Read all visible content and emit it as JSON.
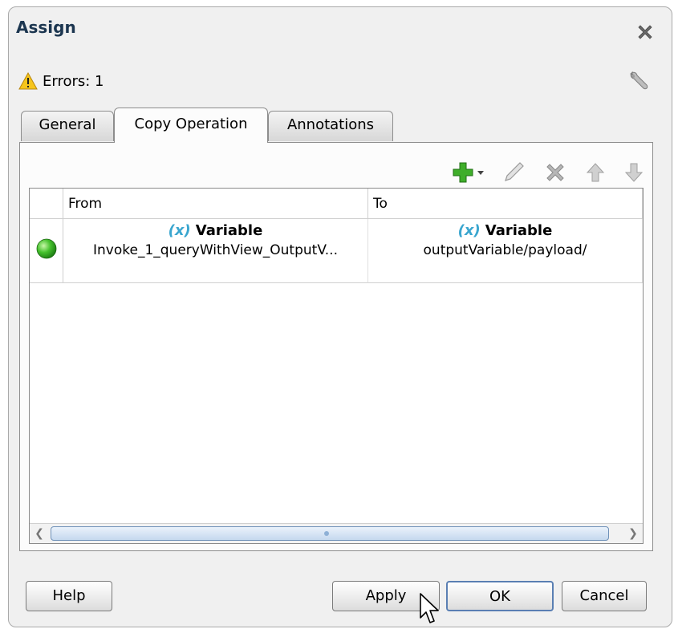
{
  "dialog": {
    "title": "Assign",
    "errors_label": "Errors: 1"
  },
  "tabs": [
    {
      "label": "General",
      "selected": false
    },
    {
      "label": "Copy Operation",
      "selected": true
    },
    {
      "label": "Annotations",
      "selected": false
    }
  ],
  "toolbar": {
    "icons": [
      "add-icon",
      "edit-icon",
      "delete-icon",
      "move-up-icon",
      "move-down-icon"
    ]
  },
  "table": {
    "columns": [
      "From",
      "To"
    ],
    "rows": [
      {
        "status_color": "#2db52d",
        "from_type_icon": "(x)",
        "from_type": "Variable",
        "from_value": "Invoke_1_queryWithView_OutputV...",
        "to_type_icon": "(x)",
        "to_type": "Variable",
        "to_value": "outputVariable/payload/"
      }
    ]
  },
  "buttons": {
    "help": "Help",
    "apply": "Apply",
    "ok": "OK",
    "cancel": "Cancel"
  }
}
